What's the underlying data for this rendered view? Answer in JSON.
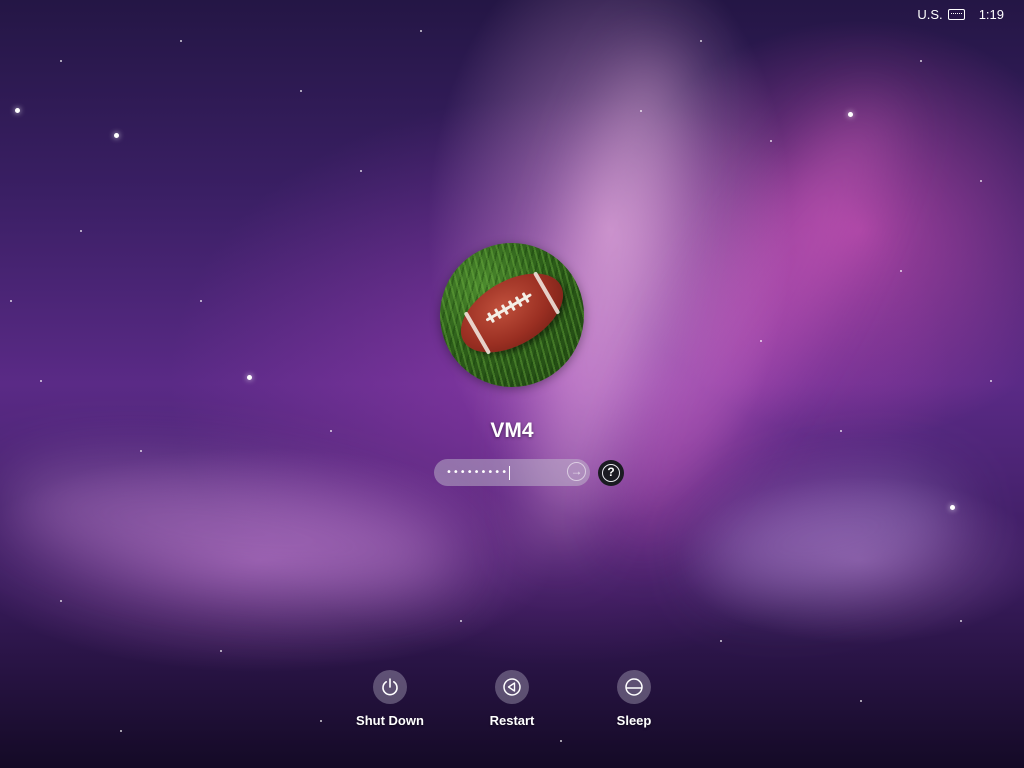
{
  "menubar": {
    "input_source": "U.S.",
    "input_icon": "keyboard-icon",
    "clock": "1:19"
  },
  "user": {
    "avatar_icon": "football-avatar",
    "name": "VM4"
  },
  "password_field": {
    "value_masked": "•••••••••",
    "submit_icon": "arrow-right-circle-icon"
  },
  "help": {
    "icon": "question-mark-icon",
    "label": "?"
  },
  "power_actions": [
    {
      "label": "Shut Down",
      "icon": "power-icon"
    },
    {
      "label": "Restart",
      "icon": "restart-icon"
    },
    {
      "label": "Sleep",
      "icon": "sleep-icon"
    }
  ],
  "colors": {
    "text": "#ffffff",
    "button_circle": "#b4afc3",
    "help_button_bg": "#1b1b22"
  }
}
